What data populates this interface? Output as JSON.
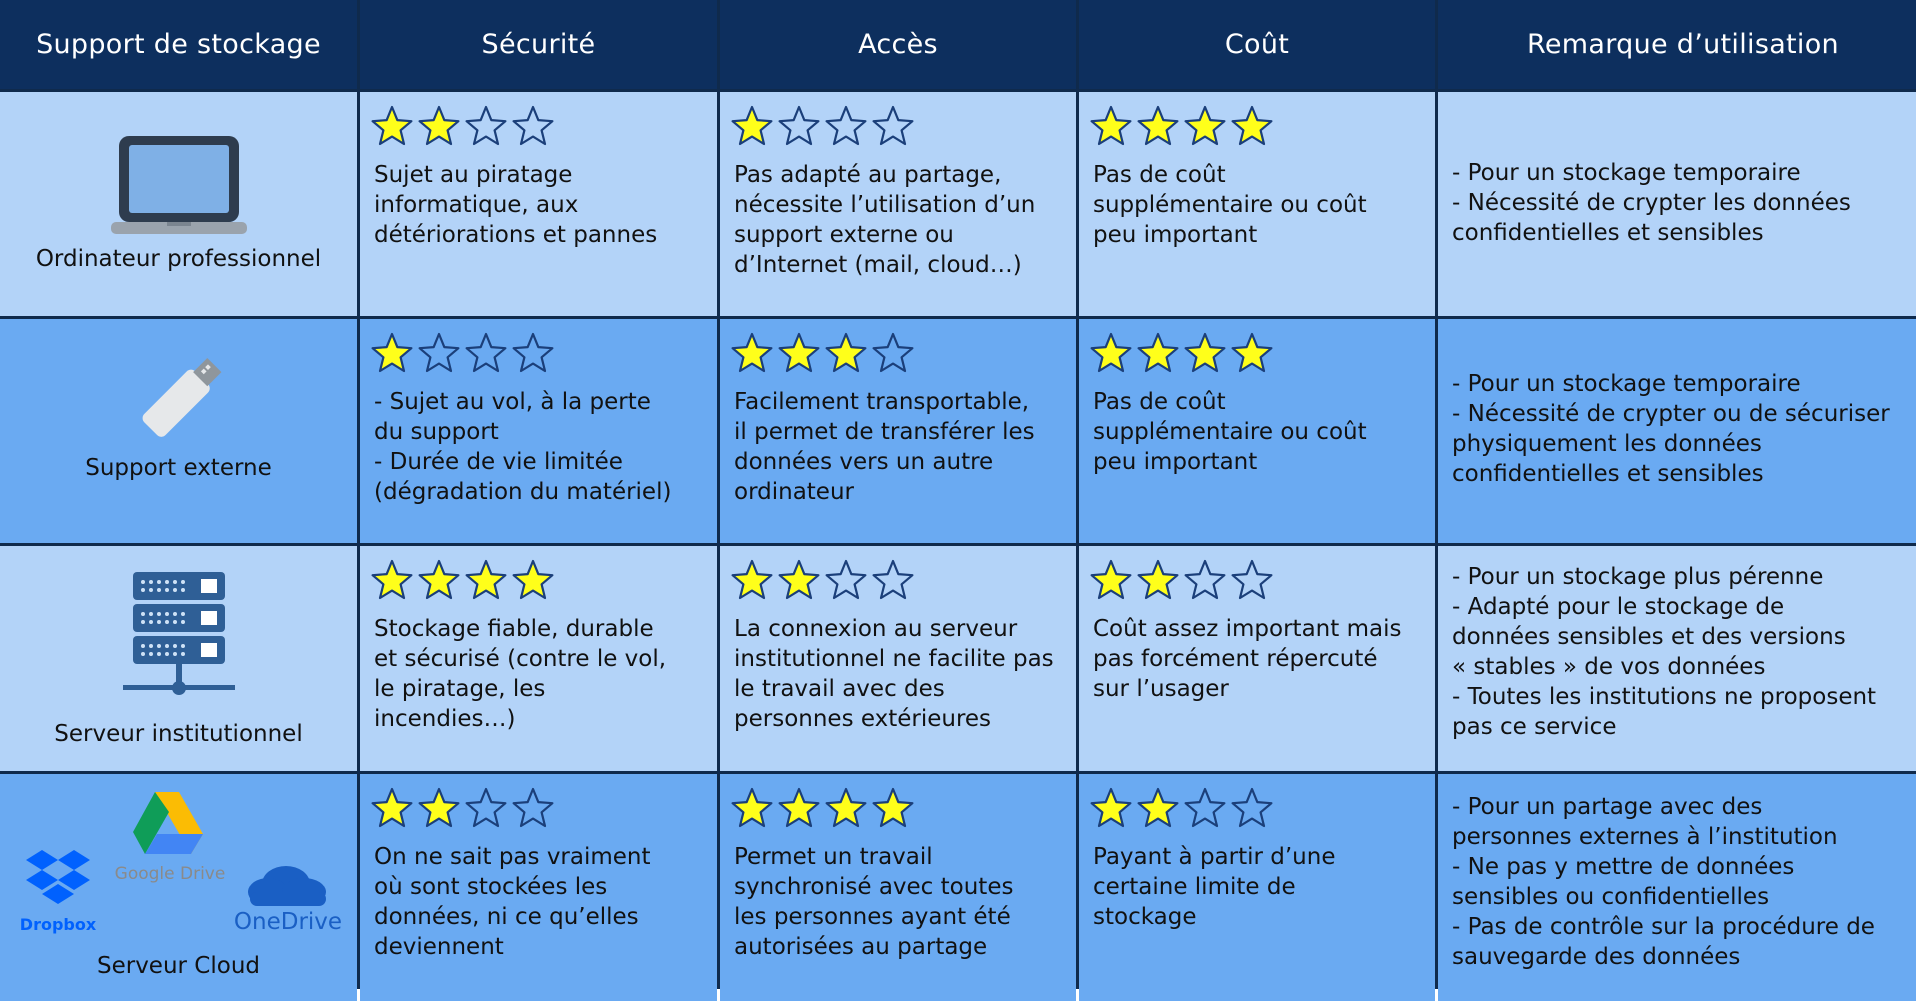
{
  "headers": [
    "Support de stockage",
    "Sécurité",
    "Accès",
    "Coût",
    "Remarque d’utilisation"
  ],
  "colors": {
    "header_bg": "#0d2f5e",
    "row_light": "#b3d3f8",
    "row_dark": "#6aaaf2",
    "star_filled": "#ffff1a",
    "star_outline": "#1b3f7a"
  },
  "rows": [
    {
      "support": "Ordinateur professionnel",
      "icon": "laptop-icon",
      "securite_stars": 2,
      "securite": "Sujet au piratage\ninformatique, aux\ndétériorations et pannes",
      "acces_stars": 1,
      "acces": "Pas adapté au partage,\nnécessite l’utilisation d’un\nsupport externe ou\nd’Internet (mail, cloud…)",
      "cout_stars": 4,
      "cout": "Pas de coût\nsupplémentaire ou coût\npeu important",
      "remarque": "- Pour un stockage temporaire\n- Nécessité de crypter les données\nconfidentielles et sensibles"
    },
    {
      "support": "Support externe",
      "icon": "usb-drive-icon",
      "securite_stars": 1,
      "securite": "- Sujet au vol, à la perte\ndu support\n- Durée de vie limitée\n(dégradation du matériel)",
      "acces_stars": 3,
      "acces": "Facilement transportable,\nil permet de transférer les\ndonnées vers un autre\nordinateur",
      "cout_stars": 4,
      "cout": "Pas de coût\nsupplémentaire ou coût\npeu important",
      "remarque": "- Pour un stockage temporaire\n- Nécessité de crypter ou de sécuriser\nphysiquement les données\nconfidentielles et sensibles"
    },
    {
      "support": "Serveur institutionnel",
      "icon": "server-icon",
      "securite_stars": 4,
      "securite": "Stockage fiable, durable\net sécurisé (contre le vol,\nle piratage, les\nincendies…)",
      "acces_stars": 2,
      "acces": "La connexion au serveur\ninstitutionnel ne facilite pas\nle travail avec des\npersonnes extérieures",
      "cout_stars": 2,
      "cout": "Coût assez important mais\npas forcément répercuté\nsur l’usager",
      "remarque": "- Pour un stockage plus pérenne\n- Adapté pour le stockage de\ndonnées sensibles et des versions\n« stables » de vos données\n- Toutes les institutions ne proposent\npas ce service"
    },
    {
      "support": "Serveur Cloud",
      "icon": "cloud-services-icon",
      "cloud_logos": [
        "Dropbox",
        "Google Drive",
        "OneDrive"
      ],
      "securite_stars": 2,
      "securite": "On ne sait pas vraiment\noù sont stockées les\ndonnées, ni ce qu’elles\ndeviennent",
      "acces_stars": 4,
      "acces": "Permet un travail\nsynchronisé avec toutes\nles personnes ayant été\nautorisées au partage",
      "cout_stars": 2,
      "cout": "Payant à partir d’une\ncertaine limite de\nstockage",
      "remarque": "- Pour un partage avec des\npersonnes externes à l’institution\n- Ne pas y mettre de données\nsensibles ou confidentielles\n- Pas de contrôle sur la procédure de\nsauvegarde des données"
    }
  ]
}
